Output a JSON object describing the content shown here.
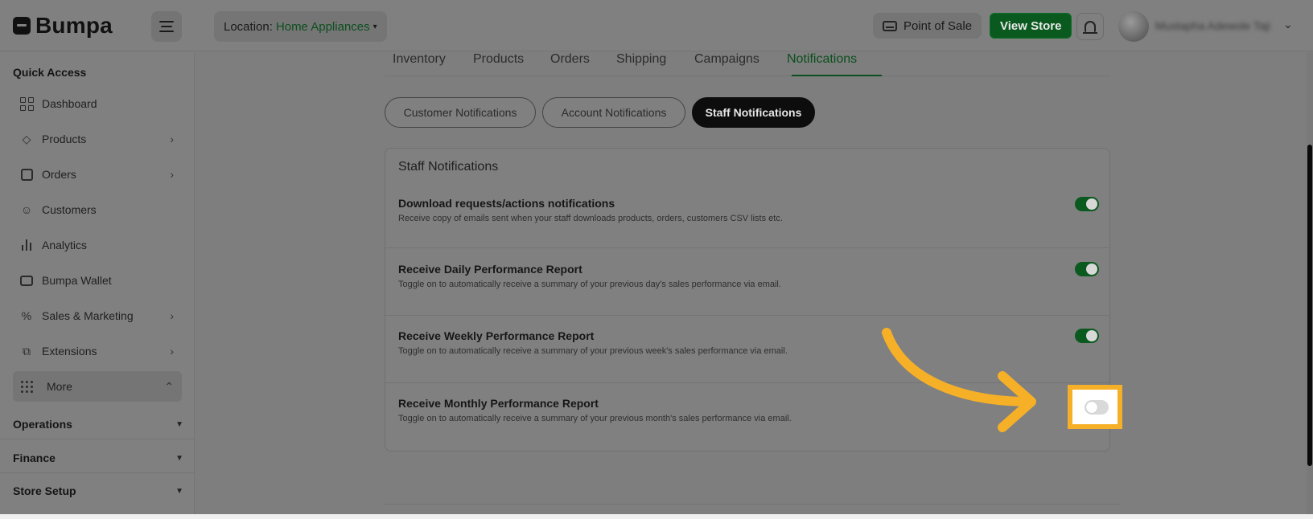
{
  "header": {
    "logo_text": "Bumpa",
    "location_label": "Location:",
    "location_value": "Home Appliances",
    "location_caret": "▾",
    "pos_label": "Point of Sale",
    "view_store_label": "View Store",
    "user_name": "Mustapha Adewole Taji",
    "user_chevron": "⌄"
  },
  "sidebar": {
    "quick_access_label": "Quick Access",
    "items": [
      {
        "label": "Dashboard",
        "icon": "dashboard-icon",
        "chevron": ""
      },
      {
        "label": "Products",
        "icon": "tag-icon",
        "chevron": "›"
      },
      {
        "label": "Orders",
        "icon": "orders-icon",
        "chevron": "›"
      },
      {
        "label": "Customers",
        "icon": "customers-icon",
        "chevron": ""
      },
      {
        "label": "Analytics",
        "icon": "analytics-icon",
        "chevron": ""
      },
      {
        "label": "Bumpa Wallet",
        "icon": "wallet-icon",
        "chevron": ""
      },
      {
        "label": "Sales & Marketing",
        "icon": "percent-icon",
        "chevron": "›"
      },
      {
        "label": "Extensions",
        "icon": "extensions-icon",
        "chevron": "›"
      }
    ],
    "more_label": "More",
    "more_chevron": "⌃",
    "groups": [
      {
        "label": "Operations",
        "caret": "▼"
      },
      {
        "label": "Finance",
        "caret": "▼"
      },
      {
        "label": "Store Setup",
        "caret": "▼"
      }
    ]
  },
  "tabs": [
    "Inventory",
    "Products",
    "Orders",
    "Shipping",
    "Campaigns",
    "Notifications"
  ],
  "active_tab": "Notifications",
  "subtabs": [
    "Customer Notifications",
    "Account Notifications",
    "Staff Notifications"
  ],
  "active_subtab": "Staff Notifications",
  "card": {
    "title": "Staff Notifications",
    "rows": [
      {
        "title": "Download requests/actions notifications",
        "desc": "Receive copy of emails sent when your staff downloads products, orders, customers CSV lists etc.",
        "enabled": true
      },
      {
        "title": "Receive Daily Performance Report",
        "desc": "Toggle on to automatically receive a summary of your previous day's sales performance via email.",
        "enabled": true
      },
      {
        "title": "Receive Weekly Performance Report",
        "desc": "Toggle on to automatically receive a summary of your previous week's sales performance via email.",
        "enabled": true
      },
      {
        "title": "Receive Monthly Performance Report",
        "desc": "Toggle on to automatically receive a summary of your previous month's sales performance via email.",
        "enabled": false
      }
    ]
  },
  "colors": {
    "accent_green": "#0a5a1f",
    "annotation_orange": "#f6b027"
  }
}
